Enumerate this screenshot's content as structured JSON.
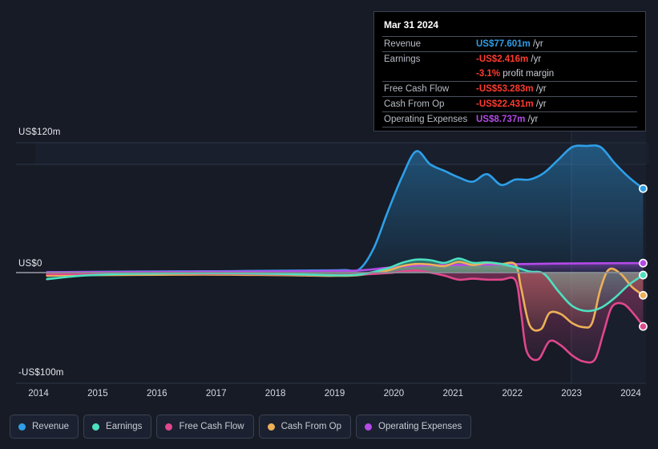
{
  "chart_data": {
    "type": "area",
    "title": "",
    "xlabel": "",
    "ylabel": "",
    "xlim": [
      2013.6,
      2024.3
    ],
    "ylim": [
      -100,
      120
    ],
    "yticks": [
      {
        "value": 120,
        "label": "US$120m"
      },
      {
        "value": 0,
        "label": "US$0"
      },
      {
        "value": -100,
        "label": "-US$100m"
      }
    ],
    "xticks": [
      "2014",
      "2015",
      "2016",
      "2017",
      "2018",
      "2019",
      "2020",
      "2021",
      "2022",
      "2023",
      "2024"
    ],
    "grid": true,
    "legend_position": "bottom-left",
    "currency_unit": "US$m",
    "series": [
      {
        "name": "Revenue",
        "color": "#2e9fe8",
        "x": [
          2013.75,
          2014.25,
          2014.75,
          2015.25,
          2015.75,
          2016.25,
          2016.75,
          2017.25,
          2017.75,
          2018.25,
          2018.75,
          2019.0,
          2019.25,
          2019.5,
          2019.75,
          2020.0,
          2020.25,
          2020.5,
          2020.75,
          2021.0,
          2021.25,
          2021.5,
          2021.75,
          2022.0,
          2022.25,
          2022.5,
          2022.75,
          2023.0,
          2023.25,
          2023.5,
          2023.75,
          2024.0,
          2024.25
        ],
        "values": [
          0.4,
          0.6,
          0.8,
          1.0,
          1.1,
          1.2,
          1.3,
          1.5,
          1.7,
          1.9,
          2.1,
          2.4,
          3.0,
          22.0,
          56.0,
          88.0,
          112.0,
          100.0,
          94.0,
          88.0,
          84.0,
          91.0,
          81.0,
          86.0,
          86.0,
          92.0,
          104.0,
          116.0,
          117.0,
          116.0,
          101.0,
          88.0,
          77.601
        ]
      },
      {
        "name": "Earnings",
        "color": "#4de0c0",
        "x": [
          2013.75,
          2014.25,
          2014.75,
          2015.25,
          2015.75,
          2016.25,
          2016.75,
          2017.25,
          2017.75,
          2018.25,
          2018.75,
          2019.25,
          2019.75,
          2020.0,
          2020.25,
          2020.5,
          2020.75,
          2021.0,
          2021.25,
          2021.5,
          2021.75,
          2022.0,
          2022.25,
          2022.5,
          2022.75,
          2023.0,
          2023.25,
          2023.5,
          2023.75,
          2024.0,
          2024.25
        ],
        "values": [
          -6.5,
          -3.5,
          -2.0,
          -1.2,
          -0.8,
          -0.6,
          -0.6,
          -0.8,
          -1.2,
          -1.8,
          -2.6,
          -2.0,
          4.0,
          9.0,
          12.0,
          11.5,
          9.0,
          13.0,
          9.0,
          9.5,
          8.0,
          5.0,
          1.0,
          -1.0,
          -18.0,
          -33.0,
          -38.0,
          -35.0,
          -25.0,
          -12.0,
          -2.416
        ]
      },
      {
        "name": "Free Cash Flow",
        "color": "#e0478c",
        "x": [
          2013.75,
          2014.25,
          2014.75,
          2015.25,
          2015.75,
          2016.25,
          2016.75,
          2017.25,
          2017.75,
          2018.25,
          2018.75,
          2019.25,
          2019.75,
          2020.0,
          2020.25,
          2020.5,
          2020.75,
          2021.0,
          2021.25,
          2021.5,
          2021.75,
          2022.0,
          2022.1,
          2022.2,
          2022.4,
          2022.6,
          2022.8,
          2023.0,
          2023.2,
          2023.4,
          2023.55,
          2023.7,
          2023.9,
          2024.1,
          2024.25
        ],
        "values": [
          -1.5,
          -1.3,
          -1.2,
          -1.1,
          -1.0,
          -1.0,
          -1.1,
          -1.3,
          -1.6,
          -2.0,
          -2.5,
          -2.0,
          -0.5,
          1.0,
          2.0,
          0.0,
          -3.0,
          -7.0,
          -6.0,
          -7.0,
          -7.0,
          -7.5,
          -40.0,
          -78.0,
          -86.0,
          -68.0,
          -72.0,
          -82.0,
          -88.0,
          -86.0,
          -60.0,
          -34.0,
          -31.0,
          -42.0,
          -53.283
        ]
      },
      {
        "name": "Cash From Op",
        "color": "#edb057",
        "x": [
          2013.75,
          2014.25,
          2014.75,
          2015.25,
          2015.75,
          2016.25,
          2016.75,
          2017.25,
          2017.75,
          2018.25,
          2018.75,
          2019.25,
          2019.75,
          2020.0,
          2020.25,
          2020.5,
          2020.75,
          2021.0,
          2021.25,
          2021.5,
          2021.75,
          2022.0,
          2022.1,
          2022.25,
          2022.45,
          2022.6,
          2022.8,
          2023.0,
          2023.2,
          2023.35,
          2023.5,
          2023.65,
          2023.85,
          2024.05,
          2024.25
        ],
        "values": [
          -3.0,
          -2.6,
          -2.4,
          -2.2,
          -2.1,
          -2.0,
          -2.0,
          -2.2,
          -2.4,
          -2.8,
          -3.2,
          -2.4,
          2.0,
          6.0,
          8.0,
          7.5,
          6.0,
          10.0,
          7.0,
          9.0,
          8.0,
          7.5,
          -15.0,
          -52.0,
          -56.0,
          -40.0,
          -41.0,
          -50.0,
          -54.0,
          -50.0,
          -16.0,
          3.0,
          -1.0,
          -14.0,
          -22.431
        ]
      },
      {
        "name": "Operating Expenses",
        "color": "#b44ae8",
        "x": [
          2013.75,
          2014.25,
          2014.75,
          2015.25,
          2015.75,
          2016.25,
          2016.75,
          2017.25,
          2017.75,
          2018.25,
          2018.75,
          2019.25,
          2019.75,
          2020.25,
          2020.75,
          2021.25,
          2021.75,
          2022.25,
          2022.75,
          2023.25,
          2023.75,
          2024.25
        ],
        "values": [
          0.3,
          0.4,
          0.5,
          0.6,
          0.7,
          0.8,
          0.9,
          1.0,
          1.2,
          1.4,
          1.6,
          2.0,
          4.5,
          6.5,
          7.0,
          7.2,
          7.6,
          8.0,
          8.4,
          8.6,
          8.7,
          8.737
        ]
      }
    ]
  },
  "tooltip": {
    "title": "Mar 31 2024",
    "rows": [
      {
        "label": "Revenue",
        "value": "US$77.601m",
        "unit": "/yr",
        "color": "#2e9fe8",
        "rule": true
      },
      {
        "label": "Earnings",
        "value": "-US$2.416m",
        "unit": "/yr",
        "color": "#ff3b30",
        "rule": true
      },
      {
        "label": "",
        "value": "-3.1%",
        "unit": "profit margin",
        "color": "#ff3b30",
        "rule": false
      },
      {
        "label": "Free Cash Flow",
        "value": "-US$53.283m",
        "unit": "/yr",
        "color": "#ff3b30",
        "rule": true
      },
      {
        "label": "Cash From Op",
        "value": "-US$22.431m",
        "unit": "/yr",
        "color": "#ff3b30",
        "rule": true
      },
      {
        "label": "Operating Expenses",
        "value": "US$8.737m",
        "unit": "/yr",
        "color": "#b44ae8",
        "rule": true
      }
    ]
  },
  "legend": {
    "items": [
      {
        "label": "Revenue",
        "color": "#2e9fe8"
      },
      {
        "label": "Earnings",
        "color": "#4de0c0"
      },
      {
        "label": "Free Cash Flow",
        "color": "#e0478c"
      },
      {
        "label": "Cash From Op",
        "color": "#edb057"
      },
      {
        "label": "Operating Expenses",
        "color": "#b44ae8"
      }
    ]
  },
  "theme": {
    "background": "#161b26",
    "grid_color": "#2f3746",
    "zero_line_color": "#8a8f99",
    "axis_text_color": "#d7dae0"
  }
}
